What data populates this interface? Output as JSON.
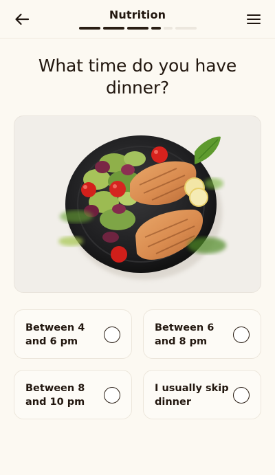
{
  "header": {
    "title": "Nutrition",
    "back_icon": "arrow-left-icon",
    "menu_icon": "hamburger-menu-icon",
    "progress": {
      "completed": 4,
      "total": 6,
      "last_completed_partial": true
    }
  },
  "question": "What time do you have dinner?",
  "hero_image": {
    "description_icon": "dinner-plate-image"
  },
  "options": [
    {
      "label": "Between 4 and 6 pm",
      "selected": false
    },
    {
      "label": "Between 6 and 8 pm",
      "selected": false
    },
    {
      "label": "Between 8 and 10 pm",
      "selected": false
    },
    {
      "label": "I usually skip dinner",
      "selected": false
    }
  ],
  "colors": {
    "background": "#fcf9f2",
    "text": "#22170f",
    "progress_done": "#2a1e14",
    "progress_todo": "#ece7de",
    "card_border": "#ece6db"
  }
}
